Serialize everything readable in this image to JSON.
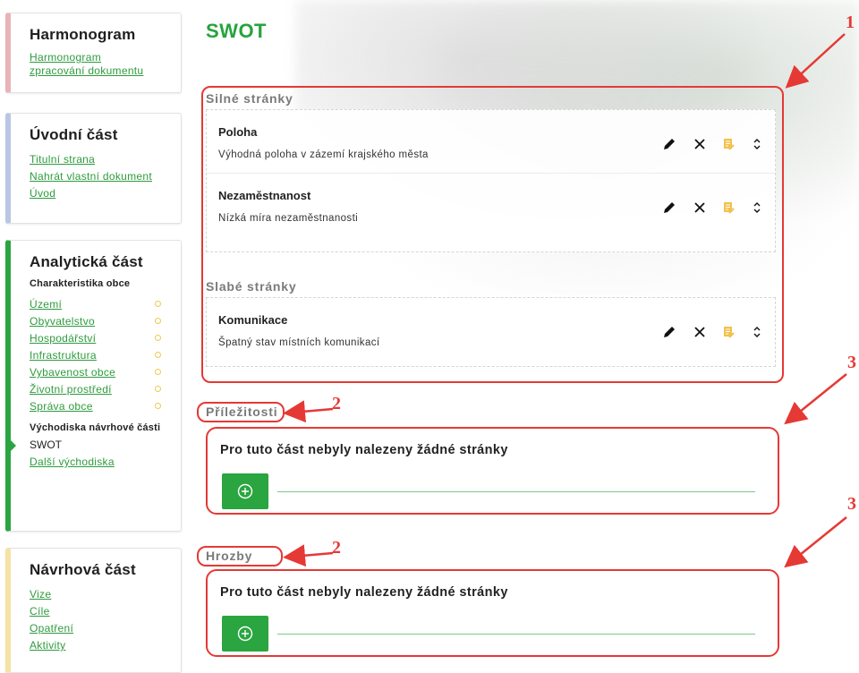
{
  "sidebar": {
    "harmonogram": {
      "title": "Harmonogram",
      "links": [
        "Harmonogram zpracování dokumentu"
      ]
    },
    "uvodni": {
      "title": "Úvodní část",
      "links": [
        "Titulní strana",
        "Nahrát vlastní dokument",
        "Úvod"
      ]
    },
    "analyticka": {
      "title": "Analytická část",
      "sub1": "Charakteristika obce",
      "links": [
        "Území",
        "Obyvatelstvo",
        "Hospodářství",
        "Infrastruktura",
        "Vybavenost obce",
        "Životní prostředí",
        "Správa obce"
      ],
      "sub2": "Východiska návrhové části",
      "active": "SWOT",
      "link_after": "Další východiska"
    },
    "navrhova": {
      "title": "Návrhová část",
      "links": [
        "Vize",
        "Cíle",
        "Opatření",
        "Aktivity"
      ]
    }
  },
  "main": {
    "title": "SWOT",
    "silne": {
      "label": "Silné stránky",
      "items": [
        {
          "title": "Poloha",
          "desc": "Výhodná poloha v zázemí krajského města"
        },
        {
          "title": "Nezaměstnanost",
          "desc": "Nízká míra nezaměstnanosti"
        }
      ]
    },
    "slabe": {
      "label": "Slabé stránky",
      "items": [
        {
          "title": "Komunikace",
          "desc": "Špatný stav místních komunikací"
        }
      ]
    },
    "prilezitosti": {
      "label": "Příležitosti",
      "empty_text": "Pro tuto část nebyly nalezeny žádné stránky"
    },
    "hrozby": {
      "label": "Hrozby",
      "empty_text": "Pro tuto část nebyly nalezeny žádné stránky"
    }
  },
  "annotations": {
    "n1": "1",
    "n2a": "2",
    "n2b": "2",
    "n3a": "3",
    "n3b": "3"
  },
  "colors": {
    "accent": "#2aa540",
    "annotation": "#e53935",
    "note_icon": "#f2c14e"
  },
  "icons": {
    "edit": "pencil-icon",
    "delete": "close-icon",
    "note": "note-icon",
    "move": "chevron-updown-icon",
    "add": "plus-circle-icon"
  }
}
